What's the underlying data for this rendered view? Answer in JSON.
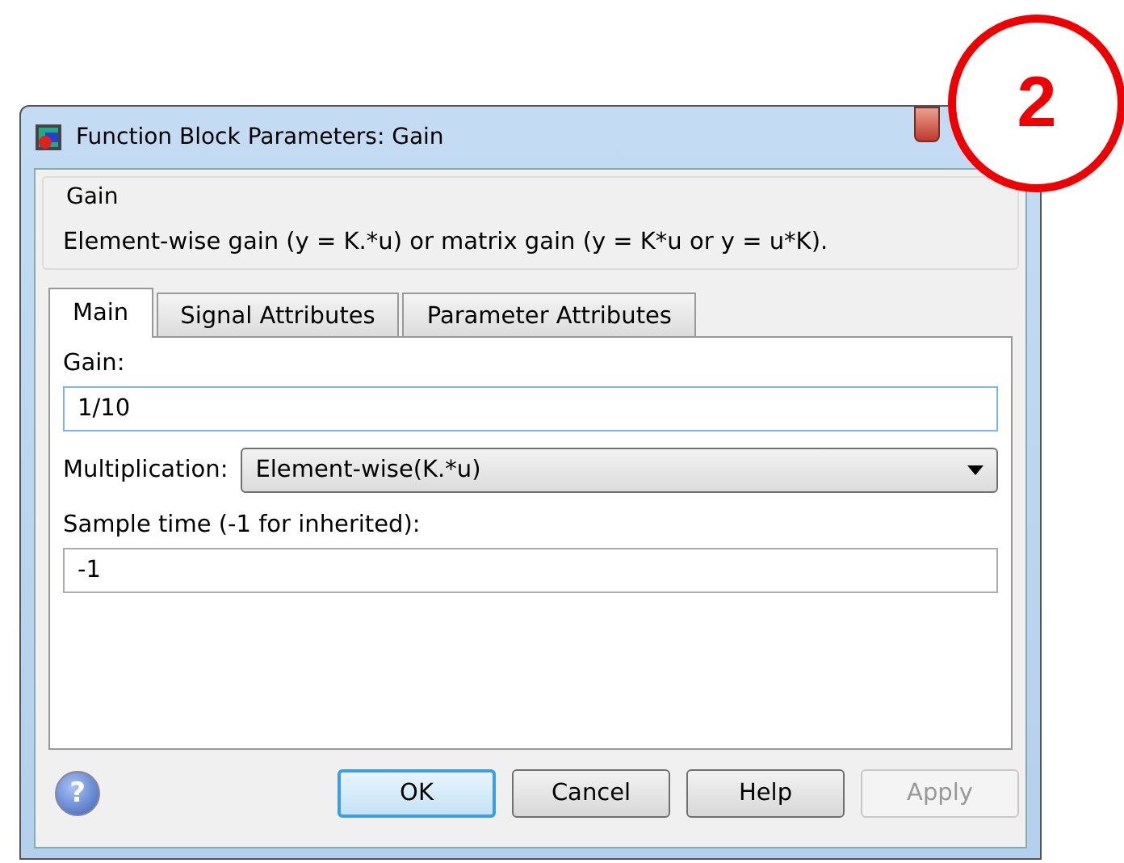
{
  "window": {
    "title": "Function Block Parameters: Gain"
  },
  "badge": {
    "text": "2"
  },
  "group": {
    "title": "Gain",
    "description": "Element-wise gain (y = K.*u) or matrix gain (y = K*u or y = u*K)."
  },
  "tabs": [
    {
      "label": "Main",
      "selected": true
    },
    {
      "label": "Signal Attributes",
      "selected": false
    },
    {
      "label": "Parameter Attributes",
      "selected": false
    }
  ],
  "fields": [
    {
      "kind": "text",
      "label": "Gain:",
      "value": "1/10",
      "focused": true
    },
    {
      "kind": "dropdown",
      "label": "Multiplication:",
      "value": "Element-wise(K.*u)"
    },
    {
      "kind": "text",
      "label": "Sample time (-1 for inherited):",
      "value": "-1",
      "focused": false
    }
  ],
  "help_icon": {
    "text": "?"
  },
  "buttons": [
    {
      "label": "OK",
      "default": true,
      "disabled": false
    },
    {
      "label": "Cancel",
      "default": false,
      "disabled": false
    },
    {
      "label": "Help",
      "default": false,
      "disabled": false
    },
    {
      "label": "Apply",
      "default": false,
      "disabled": true
    }
  ]
}
